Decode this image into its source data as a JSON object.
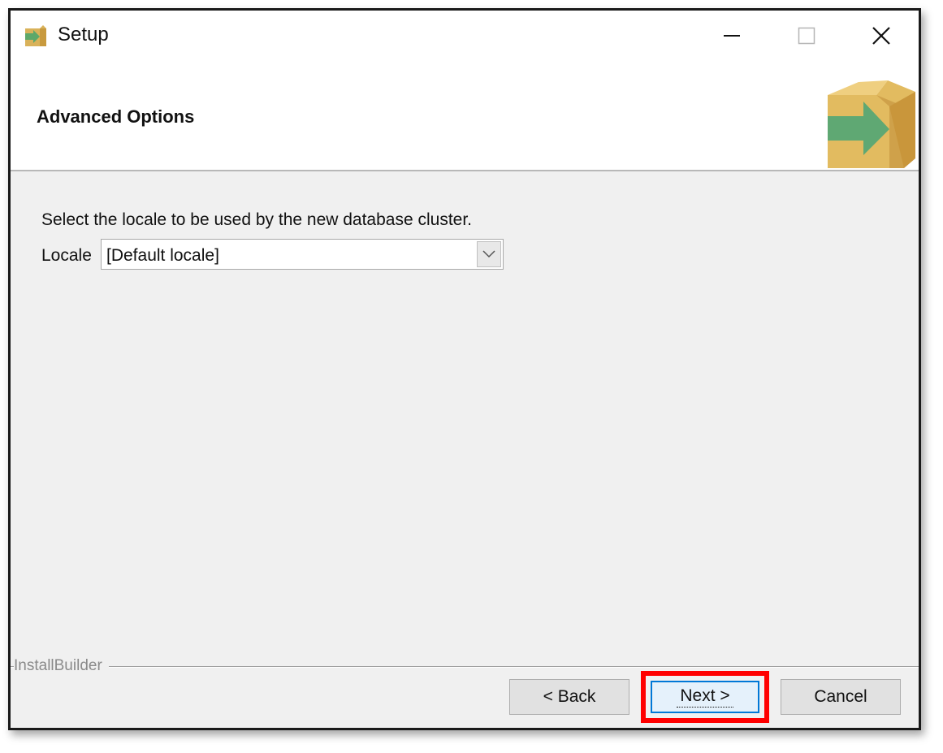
{
  "window": {
    "title": "Setup",
    "controls": {
      "minimize_icon": "minimize-icon",
      "maximize_icon": "maximize-icon",
      "close_icon": "close-icon"
    }
  },
  "header": {
    "title": "Advanced Options",
    "icon": "installer-box-arrow-icon"
  },
  "content": {
    "instruction": "Select the locale to be used by the new database cluster.",
    "locale": {
      "label": "Locale",
      "selected_value": "[Default locale]"
    }
  },
  "footer": {
    "brand": "InstallBuilder",
    "buttons": {
      "back": "< Back",
      "next": "Next >",
      "cancel": "Cancel"
    },
    "highlight_color": "#ff0000"
  }
}
